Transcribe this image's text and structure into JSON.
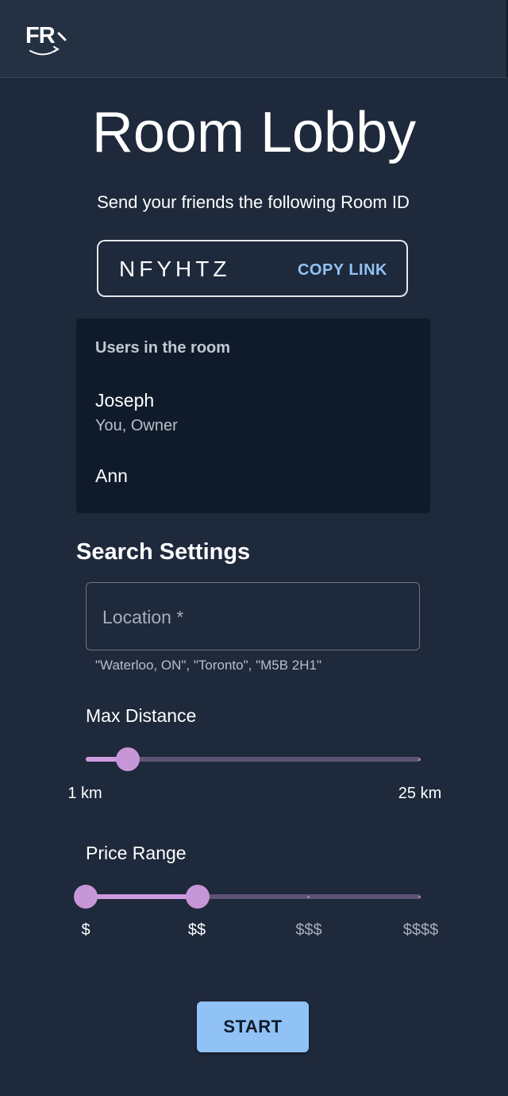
{
  "header": {
    "logo_text": "FR"
  },
  "page": {
    "title": "Room Lobby",
    "subtitle": "Send your friends the following Room ID"
  },
  "room": {
    "id": "NFYHTZ",
    "copy_label": "COPY LINK"
  },
  "users": {
    "header": "Users in the room",
    "list": [
      {
        "name": "Joseph",
        "role": "You, Owner"
      },
      {
        "name": "Ann",
        "role": ""
      }
    ]
  },
  "settings": {
    "title": "Search Settings",
    "location": {
      "placeholder": "Location *",
      "helper": "\"Waterloo, ON\", \"Toronto\", \"M5B 2H1\""
    },
    "max_distance": {
      "label": "Max Distance",
      "min_label": "1 km",
      "max_label": "25 km",
      "min": 1,
      "max": 25,
      "value": 4
    },
    "price_range": {
      "label": "Price Range",
      "marks": [
        "$",
        "$$",
        "$$$",
        "$$$$"
      ],
      "selected_low": 0,
      "selected_high": 1
    }
  },
  "actions": {
    "start_label": "START"
  },
  "colors": {
    "background": "#1e293b",
    "panel": "#0f1b2b",
    "accent": "#90c2f5",
    "slider": "#c796d8"
  }
}
